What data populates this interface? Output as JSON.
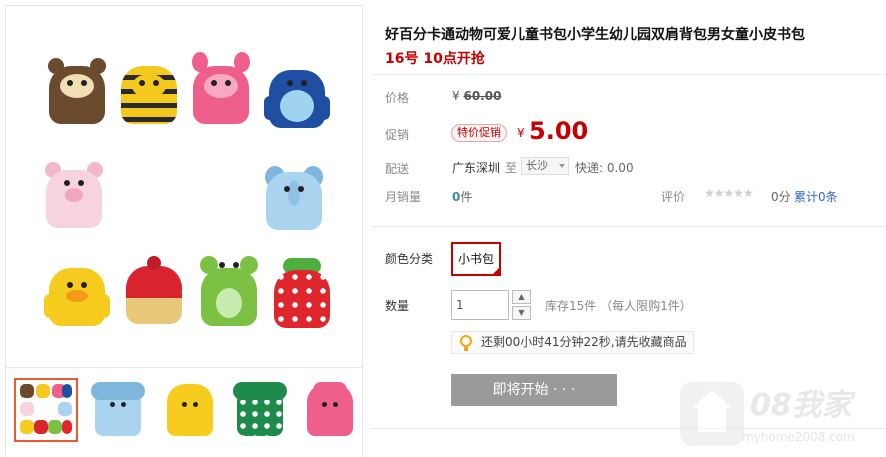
{
  "product": {
    "title": "好百分卡通动物可爱儿童书包小学生幼儿园双肩背包男女童小皮书包",
    "subtitle": "16号 10点开抢"
  },
  "price": {
    "label": "价格",
    "original_currency": "¥",
    "original": "60.00",
    "promo_label": "促销",
    "promo_tag": "特价促销",
    "promo_currency": "¥",
    "promo": "5.00"
  },
  "shipping": {
    "label": "配送",
    "from": "广东深圳",
    "to_label": "至",
    "to_city": "长沙",
    "fee": "快递: 0.00"
  },
  "sales": {
    "label": "月销量",
    "count": "0",
    "unit": "件",
    "rating_label": "评价",
    "stars": "★★★★★",
    "score": "0分",
    "reviews": "累计0条"
  },
  "sku": {
    "color_label": "颜色分类",
    "color_option": "小书包",
    "qty_label": "数量",
    "qty_value": "1",
    "stock": "库存15件 （每人限购1件）"
  },
  "notice": "还剩00小时41分钟22秒,请先收藏商品",
  "start_button": "即将开始 · · ·",
  "watermark": {
    "text": "08我家",
    "url": "myhome2008.com"
  },
  "colors": {
    "accent": "#c40000",
    "button_disabled": "#9a9a9a"
  }
}
